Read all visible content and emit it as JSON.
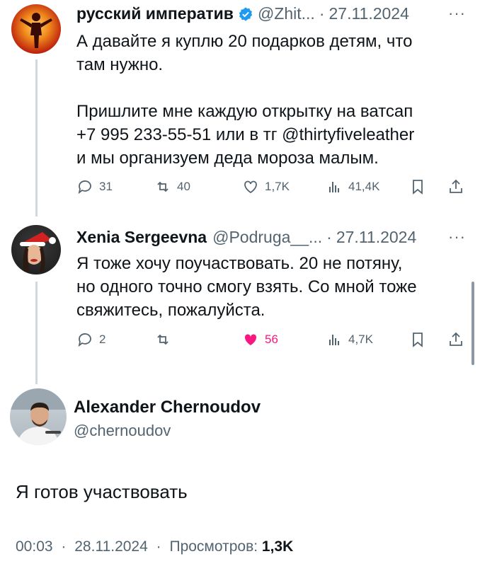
{
  "tweet1": {
    "author": "русский императив",
    "handle": "@Zhit...",
    "date": "27.11.2024",
    "text": "А давайте я куплю 20 подарков детям, что\nтам нужно.\n\nПришлите мне каждую открытку на ватсап\n+7 995 233-55-51 или в тг @thirtyfiveleather\nи мы организуем деда мороза малым.",
    "replies": "31",
    "reposts": "40",
    "likes": "1,7K",
    "views": "41,4K"
  },
  "tweet2": {
    "author": "Xenia Sergeevna",
    "handle": "@Podruga__...",
    "date": "27.11.2024",
    "text": "Я тоже хочу поучаствовать. 20 не потяну,\nно одного точно смогу взять. Со мной тоже\nсвяжитесь, пожалуйста.",
    "replies": "2",
    "reposts": "",
    "likes": "56",
    "views": "4,7K"
  },
  "main": {
    "author": "Alexander Chernoudov",
    "handle": "@chernoudov",
    "text": "Я готов участвовать",
    "time": "00:03",
    "date": "28.11.2024",
    "views_label": "Просмотров:",
    "views": "1,3K"
  },
  "ui": {
    "dot": "·",
    "more": "···"
  },
  "colors": {
    "accent": "#1d9bf0",
    "like": "#f91880",
    "secondary": "#536471"
  }
}
